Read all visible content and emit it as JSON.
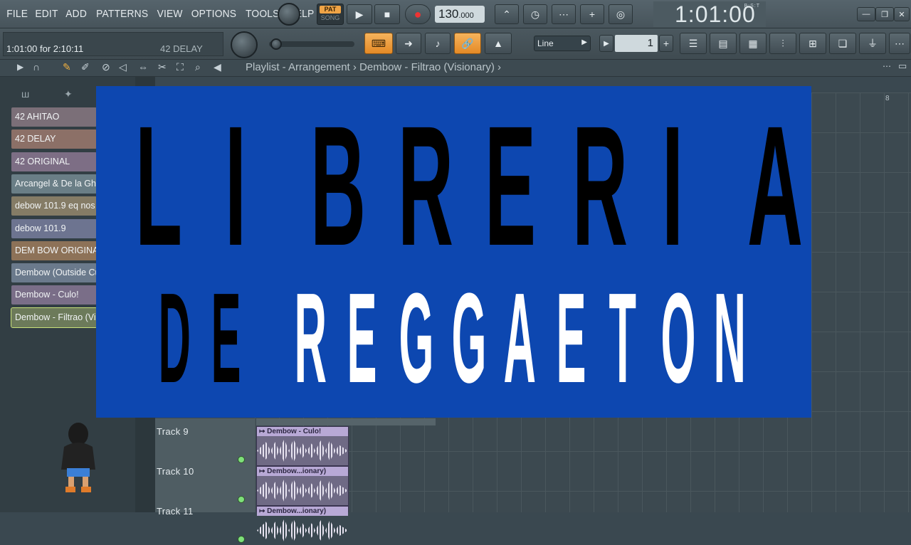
{
  "menu": [
    "FILE",
    "EDIT",
    "ADD",
    "PATTERNS",
    "VIEW",
    "OPTIONS",
    "TOOLS",
    "HELP"
  ],
  "transport": {
    "pat_label": "PAT",
    "song_label": "SONG",
    "tempo_main": "130",
    "tempo_decimal": ".000",
    "time": "1:01:00",
    "time_format": "B:S:T"
  },
  "hint": {
    "time": "1:01:00 for 2:10:11",
    "sample": "42 DELAY"
  },
  "snap": {
    "value": "Line",
    "step": "1"
  },
  "breadcrumb": "Playlist - Arrangement  ›  Dembow - Filtrao (Visionary)  ›",
  "browser_items": [
    {
      "label": "42 AHITAO",
      "color": "#7b6f78"
    },
    {
      "label": "42 DELAY",
      "color": "#8c7067"
    },
    {
      "label": "42 ORIGINAL",
      "color": "#7d6e85"
    },
    {
      "label": "Arcangel & De la Ghetto",
      "color": "#6a7e86"
    },
    {
      "label": "debow 101.9 eq nos",
      "color": "#857c66"
    },
    {
      "label": "debow 101.9",
      "color": "#6d7490"
    },
    {
      "label": "DEM BOW ORIGINAL",
      "color": "#8d7258"
    },
    {
      "label": "Dembow (Outside Cut)",
      "color": "#6b7a8c"
    },
    {
      "label": "Dembow - Culo!",
      "color": "#7a6e88"
    },
    {
      "label": "Dembow - Filtrao (Visionary)",
      "color": "#6c7a5a"
    }
  ],
  "tracks": [
    {
      "name": "Track 9",
      "clip": "↦ Dembow - Culo!"
    },
    {
      "name": "Track 10",
      "clip": "↦ Dembow...ionary)"
    },
    {
      "name": "Track 11",
      "clip": "↦ Dembow...ionary)"
    }
  ],
  "ruler_bar": "8",
  "banner": {
    "line1": [
      "L",
      "I",
      "B",
      "R",
      "E",
      "R",
      "I",
      "A"
    ],
    "line2_black": [
      "D",
      "E"
    ],
    "line2_white": [
      "R",
      "E",
      "G",
      "G",
      "A",
      "E",
      "T",
      "O",
      "N"
    ],
    "color_bg": "#0d47b0"
  }
}
